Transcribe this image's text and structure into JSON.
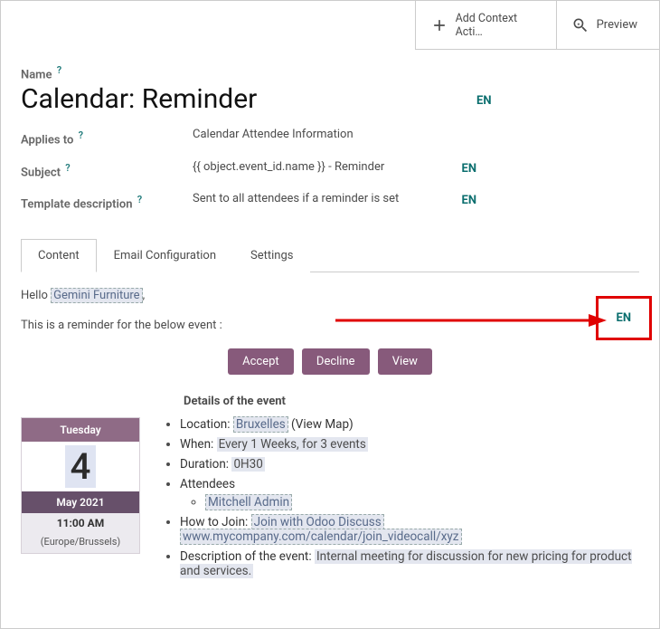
{
  "toolbar": {
    "add_context": "Add Context Acti…",
    "preview": "Preview"
  },
  "form": {
    "name_label": "Name",
    "name_value": "Calendar: Reminder",
    "name_lang": "EN",
    "applies_label": "Applies to",
    "applies_value": "Calendar Attendee Information",
    "subject_label": "Subject",
    "subject_value": "{{ object.event_id.name }} - Reminder",
    "subject_lang": "EN",
    "desc_label": "Template description",
    "desc_value": "Sent to all attendees if a reminder is set",
    "desc_lang": "EN",
    "help_mark": "?"
  },
  "tabs": {
    "content": "Content",
    "email_config": "Email Configuration",
    "settings": "Settings"
  },
  "body": {
    "hello_pre": "Hello ",
    "hello_name": "Gemini Furniture",
    "hello_post": ",",
    "body_lang": "EN",
    "reminder_line": "This is a reminder for the below event :",
    "btn_accept": "Accept",
    "btn_decline": "Decline",
    "btn_view": "View",
    "details_heading": "Details of the event"
  },
  "calendar": {
    "weekday": "Tuesday",
    "day": "4",
    "month": "May 2021",
    "time": "11:00 AM",
    "tz": "(Europe/Brussels)"
  },
  "event": {
    "loc_label": "Location: ",
    "loc_value": "Bruxelles",
    "loc_map": " (View Map)",
    "when_label": "When: ",
    "when_value": "Every 1 Weeks, for 3 events",
    "dur_label": "Duration: ",
    "dur_value": "0H30",
    "att_label": "Attendees",
    "att_1": "Mitchell Admin",
    "join_label": "How to Join: ",
    "join_value": "Join with Odoo Discuss",
    "join_url": "www.mycompany.com/calendar/join_videocall/xyz",
    "desc_label": "Description of the event: ",
    "desc_value": "Internal meeting for discussion for new pricing for product and services."
  }
}
